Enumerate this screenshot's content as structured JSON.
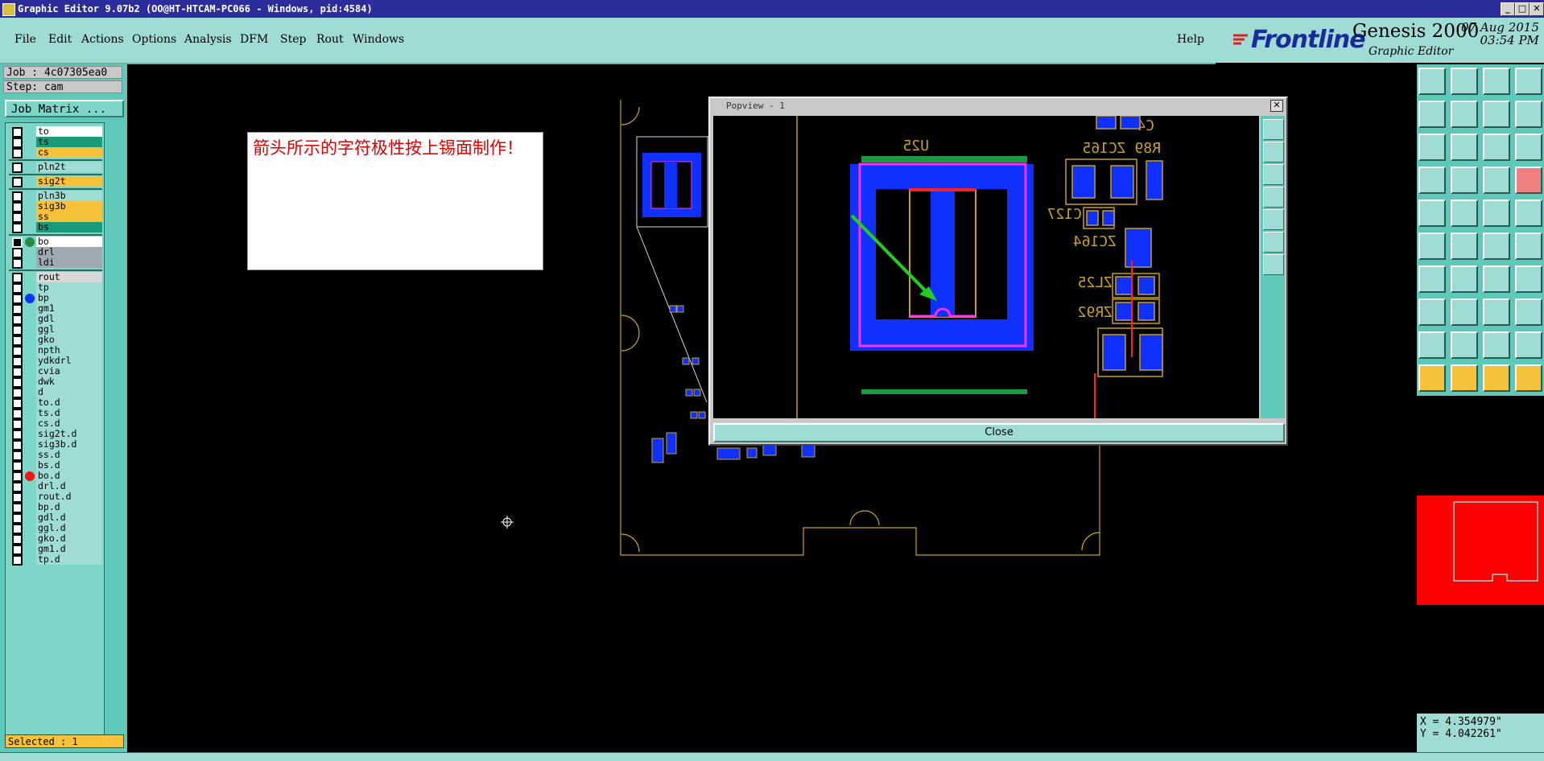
{
  "window": {
    "title": "Graphic Editor 9.07b2 (OO@HT-HTCAM-PC066 - Windows, pid:4584)",
    "controls": [
      "_",
      "□",
      "✕"
    ]
  },
  "menu": {
    "items": [
      "File",
      "Edit",
      "Actions",
      "Options",
      "Analysis",
      "DFM",
      "Step",
      "Rout",
      "Windows"
    ],
    "help": "Help"
  },
  "brand": {
    "logo": "Frontline",
    "product": "Genesis 2000",
    "subtitle": "Graphic Editor",
    "date": "07 Aug 2015",
    "time": "03:54 PM"
  },
  "job": {
    "job_label": "Job : 4c07305ea0",
    "step_label": "Step: cam",
    "matrix_button": "Job Matrix ..."
  },
  "layers": [
    {
      "name": "to",
      "color": "#ffffff",
      "checked": false
    },
    {
      "name": "ts",
      "color": "#1a9a78",
      "checked": false
    },
    {
      "name": "cs",
      "color": "#f5c23a",
      "checked": false
    },
    {
      "name": "pln2t",
      "color": "#9fdcd6",
      "checked": false
    },
    {
      "name": "sig2t",
      "color": "#f5c23a",
      "checked": false
    },
    {
      "name": "pln3b",
      "color": "#9fdcd6",
      "checked": false
    },
    {
      "name": "sig3b",
      "color": "#f5c23a",
      "checked": false
    },
    {
      "name": "ss",
      "color": "#f5c23a",
      "checked": false
    },
    {
      "name": "bs",
      "color": "#1a9a78",
      "checked": false
    },
    {
      "name": "bo",
      "color": "#ffffff",
      "checked": true,
      "active": true
    },
    {
      "name": "drl",
      "color": "#a0a8b0",
      "checked": false
    },
    {
      "name": "ldi",
      "color": "#a0a8b0",
      "checked": false
    },
    {
      "name": "rout",
      "color": "#d8d8d8",
      "checked": false
    },
    {
      "name": "tp",
      "color": "#9fdcd6",
      "checked": false
    },
    {
      "name": "bp",
      "color": "#9fdcd6",
      "checked": false,
      "dot": "#1030ff"
    },
    {
      "name": "gm1",
      "color": "#9fdcd6",
      "checked": false
    },
    {
      "name": "gdl",
      "color": "#9fdcd6",
      "checked": false
    },
    {
      "name": "ggl",
      "color": "#9fdcd6",
      "checked": false
    },
    {
      "name": "gko",
      "color": "#9fdcd6",
      "checked": false
    },
    {
      "name": "npth",
      "color": "#9fdcd6",
      "checked": false
    },
    {
      "name": "ydkdrl",
      "color": "#9fdcd6",
      "checked": false
    },
    {
      "name": "cvia",
      "color": "#9fdcd6",
      "checked": false
    },
    {
      "name": "dwk",
      "color": "#9fdcd6",
      "checked": false
    },
    {
      "name": "d",
      "color": "#9fdcd6",
      "checked": false
    },
    {
      "name": "to.d",
      "color": "#9fdcd6",
      "checked": false
    },
    {
      "name": "ts.d",
      "color": "#9fdcd6",
      "checked": false
    },
    {
      "name": "cs.d",
      "color": "#9fdcd6",
      "checked": false
    },
    {
      "name": "sig2t.d",
      "color": "#9fdcd6",
      "checked": false
    },
    {
      "name": "sig3b.d",
      "color": "#9fdcd6",
      "checked": false
    },
    {
      "name": "ss.d",
      "color": "#9fdcd6",
      "checked": false
    },
    {
      "name": "bs.d",
      "color": "#9fdcd6",
      "checked": false
    },
    {
      "name": "bo.d",
      "color": "#9fdcd6",
      "checked": false,
      "dot": "#ff1010"
    },
    {
      "name": "drl.d",
      "color": "#9fdcd6",
      "checked": false
    },
    {
      "name": "rout.d",
      "color": "#9fdcd6",
      "checked": false
    },
    {
      "name": "bp.d",
      "color": "#9fdcd6",
      "checked": false
    },
    {
      "name": "gdl.d",
      "color": "#9fdcd6",
      "checked": false
    },
    {
      "name": "ggl.d",
      "color": "#9fdcd6",
      "checked": false
    },
    {
      "name": "gko.d",
      "color": "#9fdcd6",
      "checked": false
    },
    {
      "name": "gm1.d",
      "color": "#9fdcd6",
      "checked": false
    },
    {
      "name": "tp.d",
      "color": "#9fdcd6",
      "checked": false
    }
  ],
  "selected": "Selected : 1",
  "note": {
    "text": "箭头所示的字符极性按上锡面制作！"
  },
  "popview": {
    "title": "Popview - 1",
    "close_button": "Close",
    "labels": [
      "U25",
      "C4",
      "R89",
      "ZC165",
      "C127",
      "ZC164",
      "ZL25",
      "ZR92"
    ]
  },
  "coords": {
    "x": "X = 4.354979\"",
    "y": "Y = 4.042261\""
  },
  "colors": {
    "accent": "#5ec9b9",
    "panel": "#9fdcd6",
    "board_outline": "#c8a020",
    "pad": "#1030ff",
    "silk_highlight": "#ff30ff",
    "arrow": "#20d020",
    "overview_fill": "#ff0000"
  }
}
